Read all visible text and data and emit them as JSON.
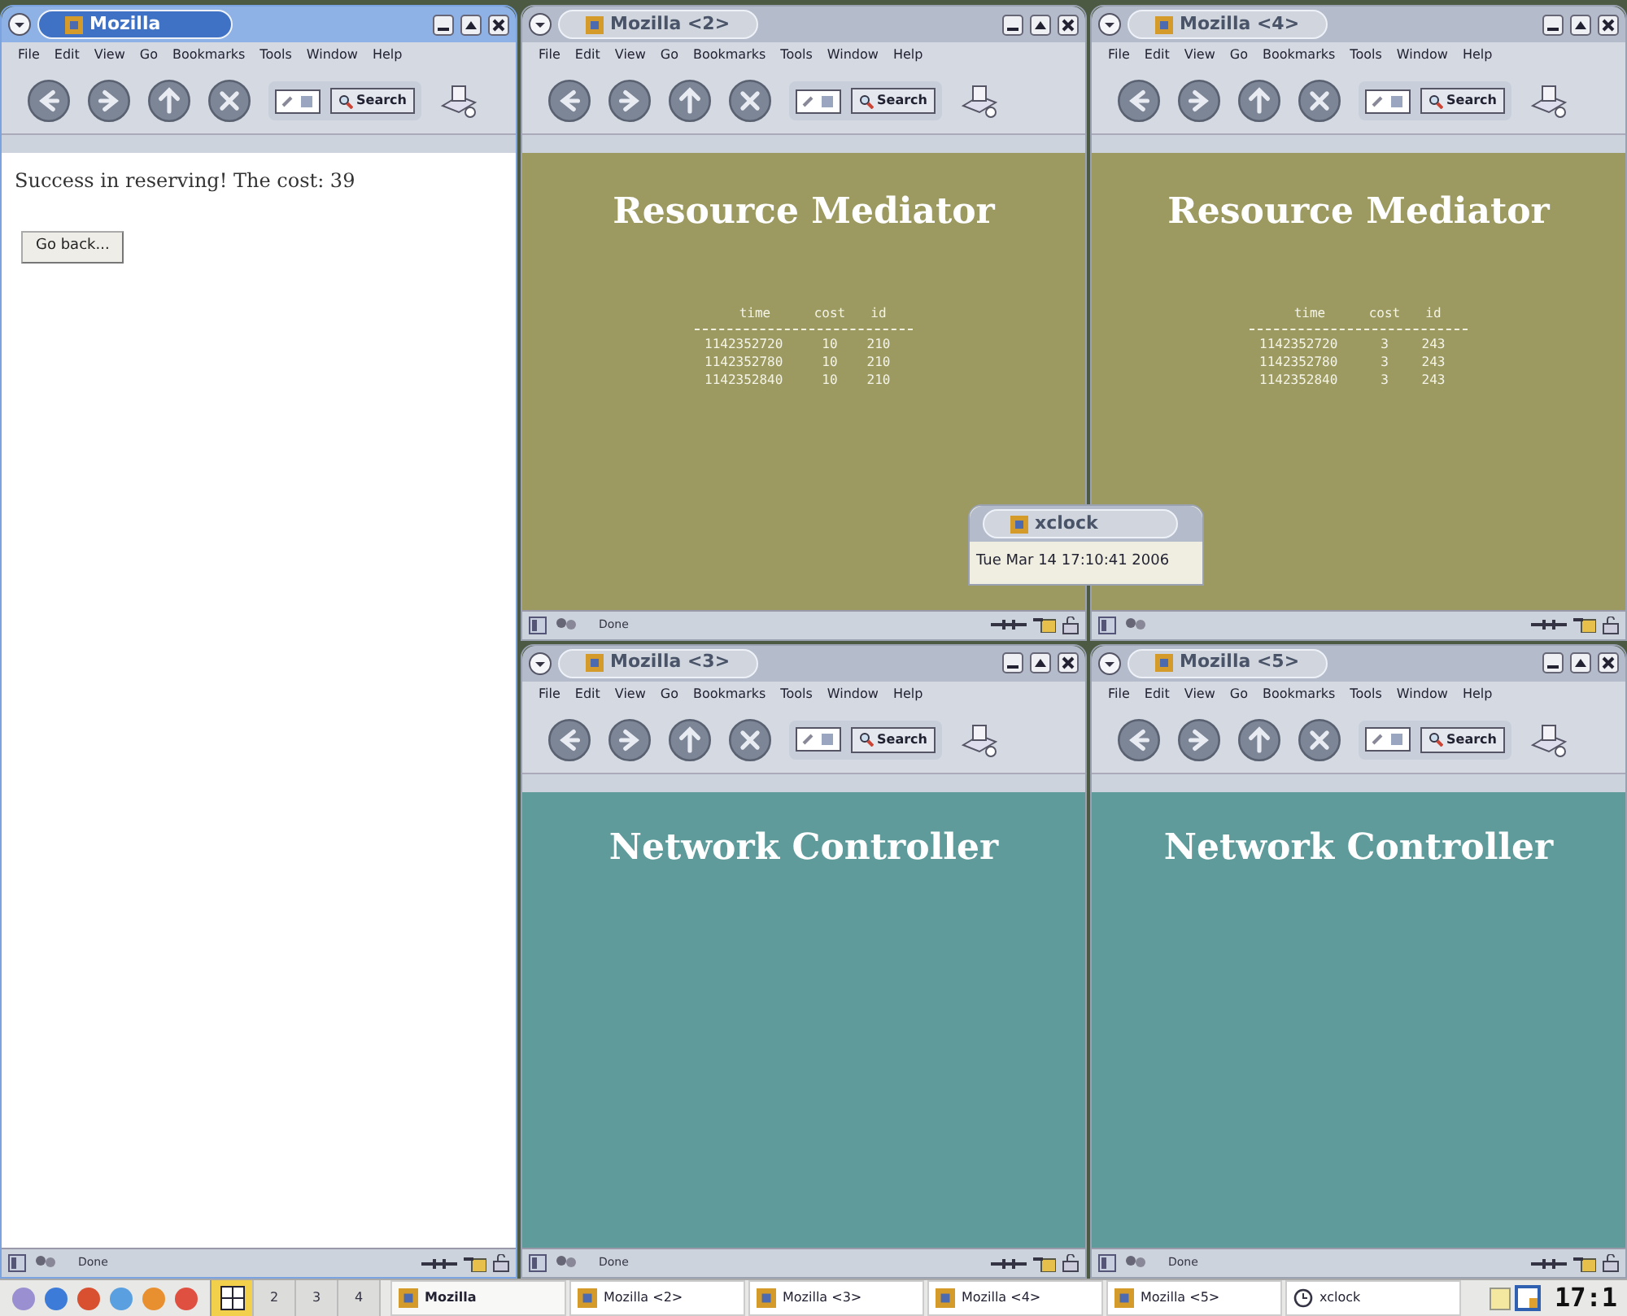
{
  "windows": [
    {
      "title": "Mozilla",
      "active": true,
      "menu": [
        "File",
        "Edit",
        "View",
        "Go",
        "Bookmarks",
        "Tools",
        "Window",
        "Help"
      ],
      "search": "Search",
      "content": {
        "kind": "message",
        "text": "Success in reserving! The cost: 39",
        "button": "Go back..."
      },
      "status": "Done"
    },
    {
      "title": "Mozilla <2>",
      "active": false,
      "menu": [
        "File",
        "Edit",
        "View",
        "Go",
        "Bookmarks",
        "Tools",
        "Window",
        "Help"
      ],
      "search": "Search",
      "content": {
        "kind": "table",
        "heading": "Resource Mediator",
        "columns": [
          "time",
          "cost",
          "id"
        ],
        "rows": [
          [
            "1142352720",
            "10",
            "210"
          ],
          [
            "1142352780",
            "10",
            "210"
          ],
          [
            "1142352840",
            "10",
            "210"
          ]
        ]
      },
      "status": "Done"
    },
    {
      "title": "Mozilla <4>",
      "active": false,
      "menu": [
        "File",
        "Edit",
        "View",
        "Go",
        "Bookmarks",
        "Tools",
        "Window",
        "Help"
      ],
      "search": "Search",
      "content": {
        "kind": "table",
        "heading": "Resource Mediator",
        "columns": [
          "time",
          "cost",
          "id"
        ],
        "rows": [
          [
            "1142352720",
            "3",
            "243"
          ],
          [
            "1142352780",
            "3",
            "243"
          ],
          [
            "1142352840",
            "3",
            "243"
          ]
        ]
      }
    },
    {
      "title": "Mozilla <3>",
      "active": false,
      "menu": [
        "File",
        "Edit",
        "View",
        "Go",
        "Bookmarks",
        "Tools",
        "Window",
        "Help"
      ],
      "search": "Search",
      "content": {
        "kind": "banner",
        "heading": "Network Controller"
      },
      "status": "Done"
    },
    {
      "title": "Mozilla <5>",
      "active": false,
      "menu": [
        "File",
        "Edit",
        "View",
        "Go",
        "Bookmarks",
        "Tools",
        "Window",
        "Help"
      ],
      "search": "Search",
      "content": {
        "kind": "banner",
        "heading": "Network Controller"
      },
      "status": "Done"
    }
  ],
  "xclock": {
    "title": "xclock",
    "time": "Tue Mar 14 17:10:41 2006"
  },
  "taskbar": {
    "desktops": [
      {
        "selected": true
      },
      {
        "label": "2",
        "selected": false
      },
      {
        "label": "3",
        "selected": false
      },
      {
        "label": "4",
        "selected": false
      }
    ],
    "tasks": [
      {
        "label": "Mozilla",
        "selected": true,
        "kind": "browser"
      },
      {
        "label": "Mozilla <2>",
        "selected": false,
        "kind": "browser"
      },
      {
        "label": "Mozilla <3>",
        "selected": false,
        "kind": "browser"
      },
      {
        "label": "Mozilla <4>",
        "selected": false,
        "kind": "browser"
      },
      {
        "label": "Mozilla <5>",
        "selected": false,
        "kind": "browser"
      },
      {
        "label": "xclock",
        "selected": false,
        "kind": "clock"
      }
    ],
    "clock": "17:1"
  }
}
